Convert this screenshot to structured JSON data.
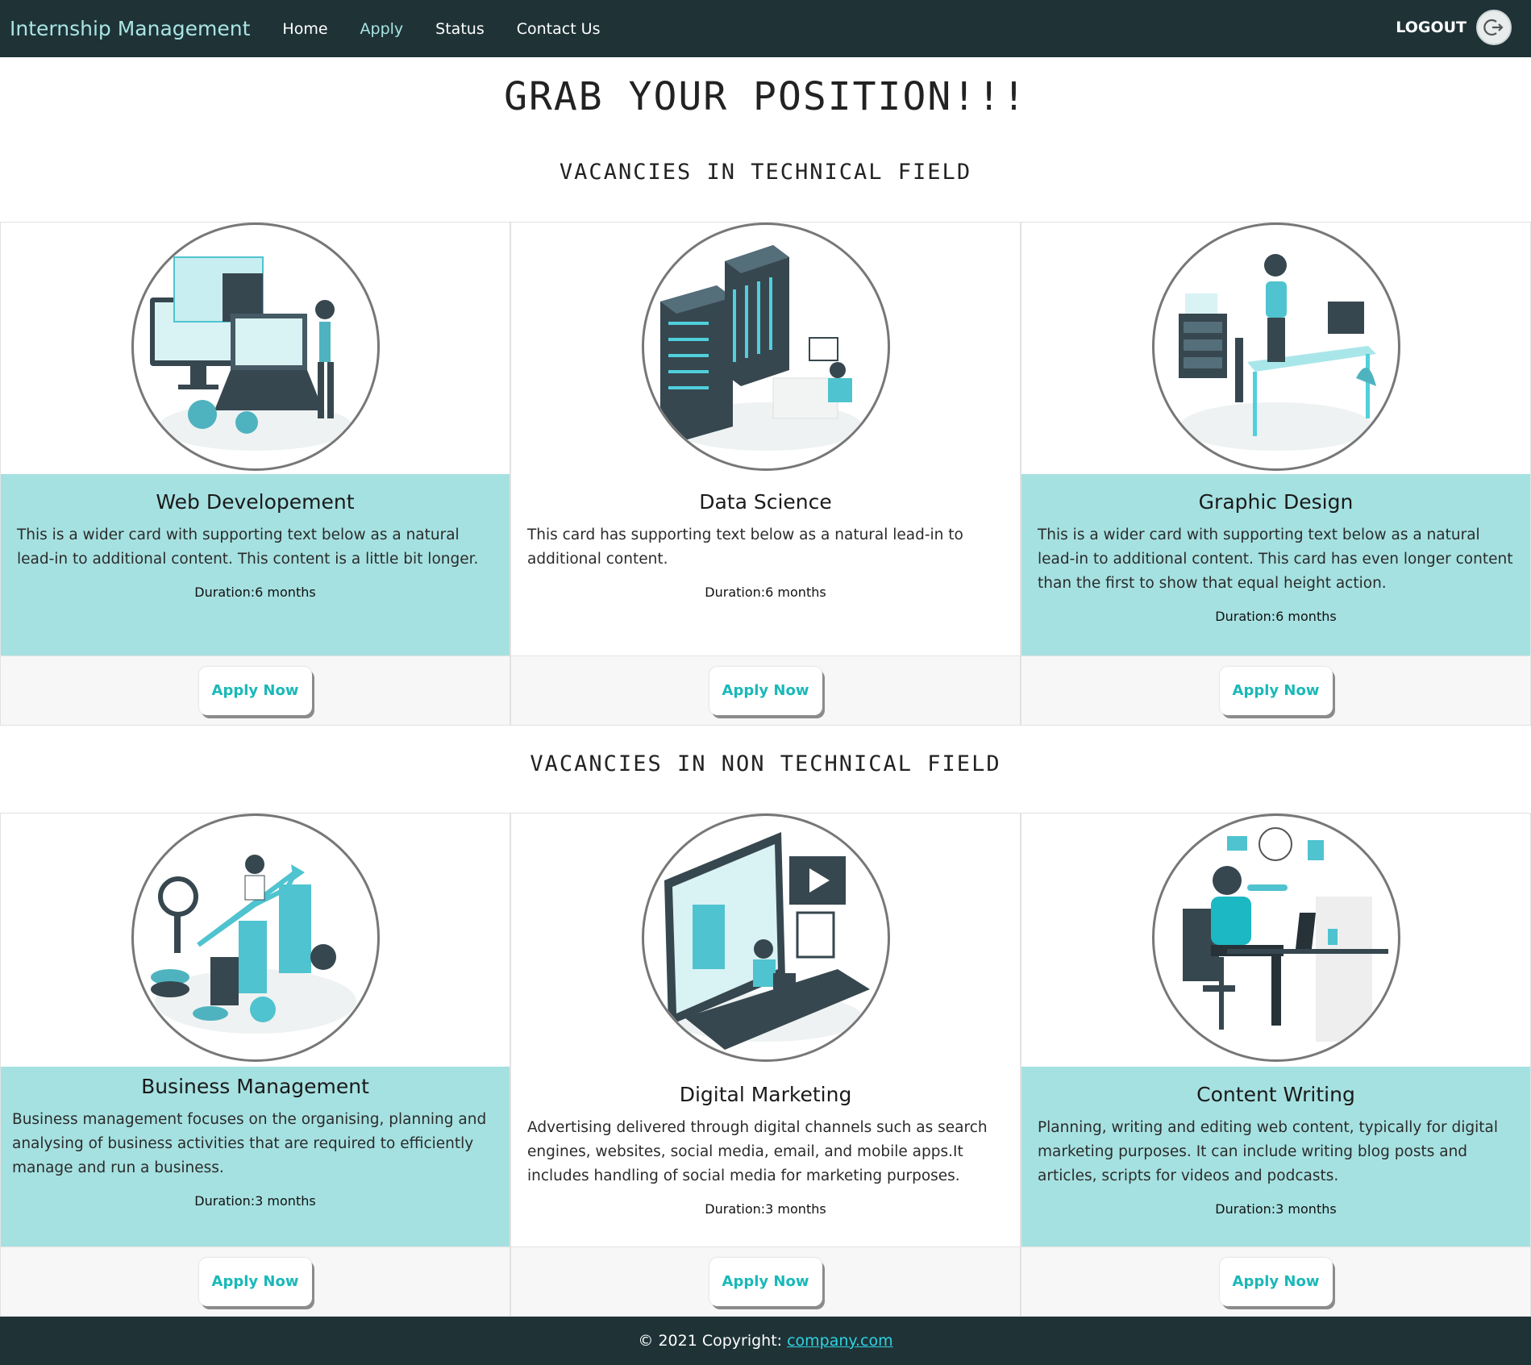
{
  "nav": {
    "brand": "Internship Management",
    "links": [
      {
        "label": "Home"
      },
      {
        "label": "Apply"
      },
      {
        "label": "Status"
      },
      {
        "label": "Contact Us"
      }
    ],
    "logout_label": "LOGOUT"
  },
  "page_title": "GRAB YOUR POSITION!!!",
  "technical": {
    "heading": "VACANCIES IN TECHNICAL FIELD",
    "cards": [
      {
        "title": "Web Developement",
        "text": "This is a wider card with supporting text below as a natural lead-in to additional content. This content is a little bit longer.",
        "duration": "Duration:6 months",
        "button": "Apply Now",
        "illustration": "web-development-illustration"
      },
      {
        "title": "Data Science",
        "text": "This card has supporting text below as a natural lead-in to additional content.",
        "duration": "Duration:6 months",
        "button": "Apply Now",
        "illustration": "data-science-illustration"
      },
      {
        "title": "Graphic Design",
        "text": "This is a wider card with supporting text below as a natural lead-in to additional content. This card has even longer content than the first to show that equal height action.",
        "duration": "Duration:6 months",
        "button": "Apply Now",
        "illustration": "graphic-design-illustration"
      }
    ]
  },
  "non_technical": {
    "heading": "VACANCIES IN NON TECHNICAL FIELD",
    "cards": [
      {
        "title": "Business Management",
        "text": "Business management focuses on the organising, planning and analysing of business activities that are required to efficiently manage and run a business.",
        "duration": "Duration:3 months",
        "button": "Apply Now",
        "illustration": "business-management-illustration"
      },
      {
        "title": "Digital Marketing",
        "text": "Advertising delivered through digital channels such as search engines, websites, social media, email, and mobile apps.It includes handling of social media for marketing purposes.",
        "duration": "Duration:3 months",
        "button": "Apply Now",
        "illustration": "digital-marketing-illustration"
      },
      {
        "title": "Content Writing",
        "text": "Planning, writing and editing web content, typically for digital marketing purposes. It can include writing blog posts and articles, scripts for videos and podcasts.",
        "duration": "Duration:3 months",
        "button": "Apply Now",
        "illustration": "content-writing-illustration"
      }
    ]
  },
  "footer": {
    "copyright": "© 2021 Copyright:",
    "link": "company.com"
  },
  "colors": {
    "navbar": "#1f3337",
    "accent_teal": "#a6e1e1",
    "button_text": "#1bb8b8",
    "footer_link": "#2fd2e2"
  }
}
